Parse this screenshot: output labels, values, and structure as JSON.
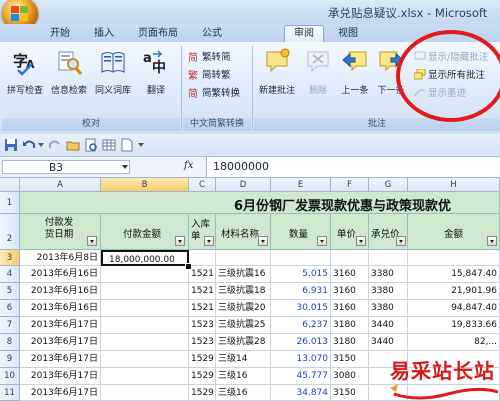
{
  "window": {
    "title": "承兑贴息疑议.xlsx - Microsoft"
  },
  "tabs": [
    "开始",
    "插入",
    "页面布局",
    "公式",
    "审阅",
    "视图"
  ],
  "active_tab": "审阅",
  "ribbon": {
    "proofing": {
      "label": "校对",
      "buttons": [
        {
          "label": "拼写检查",
          "icon": "spell-check-icon"
        },
        {
          "label": "信息检索",
          "icon": "research-icon"
        },
        {
          "label": "同义词库",
          "icon": "thesaurus-icon"
        },
        {
          "label": "翻译",
          "icon": "translate-icon"
        }
      ]
    },
    "chinese": {
      "label": "中文简繁转换",
      "buttons": [
        {
          "label": "繁转简",
          "icon": "trad-to-simp-icon"
        },
        {
          "label": "简转繁",
          "icon": "simp-to-trad-icon"
        },
        {
          "label": "简繁转换",
          "icon": "convert-icon"
        }
      ]
    },
    "comments": {
      "label": "批注",
      "buttons": [
        {
          "label": "新建批注",
          "icon": "new-comment-icon"
        },
        {
          "label": "删除",
          "icon": "delete-comment-icon"
        },
        {
          "label": "上一条",
          "icon": "previous-comment-icon"
        },
        {
          "label": "下一条",
          "icon": "next-comment-icon"
        }
      ],
      "show_hide": "显示/隐藏批注",
      "show_all": "显示所有批注",
      "show_ink": "显示墨迹"
    }
  },
  "formula_bar": {
    "name_box": "B3",
    "fx": "fx",
    "value": "18000000"
  },
  "columns": [
    "A",
    "B",
    "C",
    "D",
    "E",
    "F",
    "G",
    "H"
  ],
  "rows": [
    "1",
    "2",
    "3",
    "4",
    "5",
    "6",
    "7",
    "8",
    "9",
    "10",
    "11"
  ],
  "sheet": {
    "title": "6月份钢厂发票现款优惠与政策现款优",
    "headers": {
      "a": "付款发\n货日期",
      "b": "付款金额",
      "c": "入库\n单",
      "d": "材料名称",
      "e": "数量",
      "f": "单价",
      "g": "承兑价",
      "h": "金额"
    },
    "data": [
      {
        "a": "2013年6月8日",
        "b": "18,000,000.00",
        "c": "",
        "d": "",
        "e": "",
        "f": "",
        "g": "",
        "h": ""
      },
      {
        "a": "2013年6月16日",
        "b": "",
        "c": "1521",
        "d": "三级抗震16",
        "e": "5.015",
        "f": "3160",
        "g": "3380",
        "h": "15,847.40"
      },
      {
        "a": "2013年6月16日",
        "b": "",
        "c": "1521",
        "d": "三级抗震18",
        "e": "6.931",
        "f": "3160",
        "g": "3380",
        "h": "21,901.96"
      },
      {
        "a": "2013年6月16日",
        "b": "",
        "c": "1521",
        "d": "三级抗震20",
        "e": "30.015",
        "f": "3160",
        "g": "3380",
        "h": "94,847.40"
      },
      {
        "a": "2013年6月17日",
        "b": "",
        "c": "1523",
        "d": "三级抗震25",
        "e": "6.237",
        "f": "3180",
        "g": "3440",
        "h": "19,833.66"
      },
      {
        "a": "2013年6月17日",
        "b": "",
        "c": "1523",
        "d": "三级抗震28",
        "e": "26.013",
        "f": "3180",
        "g": "3440",
        "h": "82,..."
      },
      {
        "a": "2013年6月17日",
        "b": "",
        "c": "1529",
        "d": "三级14",
        "e": "13.070",
        "f": "3150",
        "g": "",
        "h": ""
      },
      {
        "a": "2013年6月17日",
        "b": "",
        "c": "1529",
        "d": "三级16",
        "e": "45.777",
        "f": "3080",
        "g": "",
        "h": ""
      },
      {
        "a": "2013年6月17日",
        "b": "",
        "c": "1529",
        "d": "三级16",
        "e": "34.874",
        "f": "3150",
        "g": "",
        "h": ""
      }
    ]
  },
  "watermark": "易采站长站",
  "colors": {
    "accent_circle": "#e21a1a",
    "header_fill": "#cfe8cf",
    "blue_number": "#1f3ec9"
  }
}
